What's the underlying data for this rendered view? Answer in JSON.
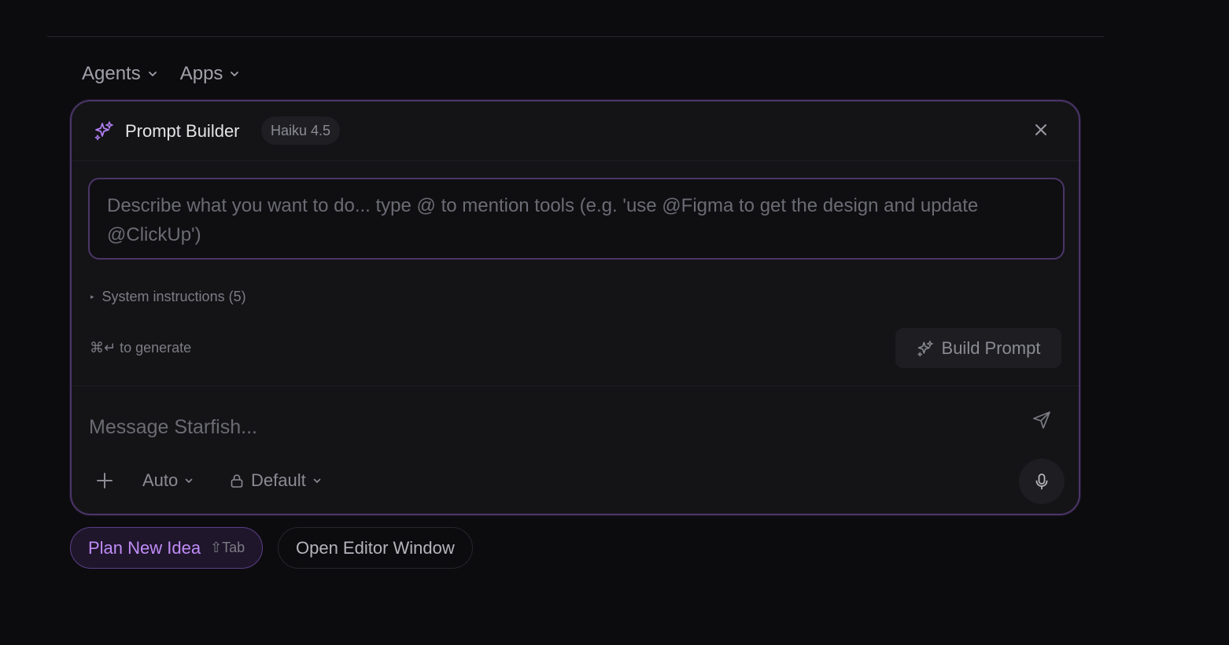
{
  "nav": {
    "agents_label": "Agents",
    "apps_label": "Apps"
  },
  "prompt_builder": {
    "title": "Prompt Builder",
    "model_badge": "Haiku 4.5",
    "textarea_placeholder": "Describe what you want to do... type @ to mention tools (e.g. 'use @Figma to get the design and update @ClickUp')",
    "system_instructions_label": "System instructions (5)",
    "generate_hint": "⌘↵ to generate",
    "build_button_label": "Build Prompt"
  },
  "composer": {
    "message_placeholder": "Message Starfish...",
    "mode_label": "Auto",
    "permission_label": "Default"
  },
  "chips": {
    "plan_label": "Plan New Idea",
    "plan_shortcut": "⇧Tab",
    "editor_label": "Open Editor Window"
  },
  "colors": {
    "accent": "#c08cf7",
    "panel_border": "#4a3566",
    "background": "#0c0c0f"
  },
  "icons": {
    "sparkle": "sparkle-icon",
    "close": "close-icon",
    "send": "send-icon",
    "plus": "plus-icon",
    "lock": "lock-icon",
    "mic": "microphone-icon",
    "chevron": "chevron-down-icon"
  }
}
